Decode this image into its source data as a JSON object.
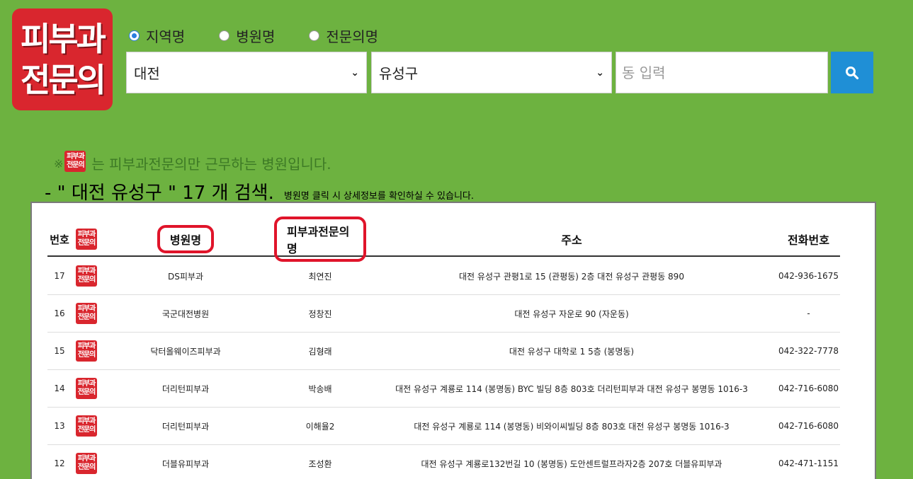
{
  "logo": {
    "line1": "피부과",
    "line2": "전문의"
  },
  "search": {
    "radios": [
      {
        "label": "지역명",
        "checked": true
      },
      {
        "label": "병원명",
        "checked": false
      },
      {
        "label": "전문의명",
        "checked": false
      }
    ],
    "region": "대전",
    "district": "유성구",
    "dong_placeholder": "동 입력"
  },
  "notice": {
    "mark": "※",
    "text": "는 피부과전문의만 근무하는 병원입니다."
  },
  "result": {
    "text": "- \" 대전 유성구 \" 17 개 검색.",
    "hint": "병원명 클릭 시 상세정보를 확인하실 수 있습니다."
  },
  "table": {
    "headers": {
      "num": "번호",
      "name": "병원명",
      "doctor": "피부과전문의명",
      "address": "주소",
      "phone": "전화번호"
    },
    "rows": [
      {
        "num": "17",
        "name": "DS피부과",
        "doctor": "최연진",
        "address": "대전 유성구 관평1로 15 (관평동) 2층 대전 유성구 관평동 890",
        "phone": "042-936-1675"
      },
      {
        "num": "16",
        "name": "국군대전병원",
        "doctor": "정창진",
        "address": "대전 유성구 자운로 90 (자운동)",
        "phone": "-"
      },
      {
        "num": "15",
        "name": "닥터올웨이즈피부과",
        "doctor": "김형래",
        "address": "대전 유성구 대학로 1 5층 (봉명동)",
        "phone": "042-322-7778"
      },
      {
        "num": "14",
        "name": "더리턴피부과",
        "doctor": "박송배",
        "address": "대전 유성구 계룡로 114 (봉명동) BYC 빌딩 8층 803호 더리턴피부과 대전 유성구 봉명동 1016-3",
        "phone": "042-716-6080"
      },
      {
        "num": "13",
        "name": "더리턴피부과",
        "doctor": "이해율2",
        "address": "대전 유성구 계룡로 114 (봉명동) 비와이씨빌딩 8층 803호 대전 유성구 봉명동 1016-3",
        "phone": "042-716-6080"
      },
      {
        "num": "12",
        "name": "더블유피부과",
        "doctor": "조성환",
        "address": "대전 유성구 계룡로132번길 10 (봉명동) 도안센트럴프라자2층 207호 더블유피부과",
        "phone": "042-471-1151"
      }
    ]
  }
}
